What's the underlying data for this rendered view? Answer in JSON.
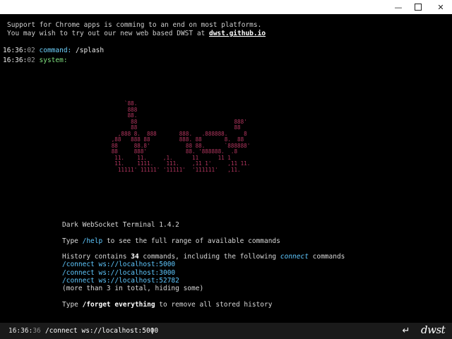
{
  "window": {
    "minimize_glyph": "—",
    "close_glyph": "✕"
  },
  "notice": {
    "line1": "Support for Chrome apps is comming to an end on most platforms.",
    "line2_prefix": "You may wish to try out our new web based DWST at ",
    "link": "dwst.github.io"
  },
  "log": [
    {
      "time_hm": "16:36:",
      "time_s": "02",
      "label": "command:",
      "value": "/splash"
    },
    {
      "time_hm": "16:36:",
      "time_s": "02",
      "label": "system:",
      "value": ""
    }
  ],
  "logo_art": "              `88.\n               888\n               88.\n                88                              888'\n                88                              88\n            ,888 8.  888       888.   .888888.     8\n          ,88   888 88         888. 88       8.  88\n          88     88.8'           88 88.      `888888'\n          88     888'            88. '888888.  .8\n           11.    11.     ,1.      11      11 1\n           11.    1111.    111.    ,11 1'     ,11 11.\n            11111' 11111' '11111'  '111111'   ,11.",
  "splash": {
    "title": "Dark WebSocket Terminal 1.4.2",
    "help_prefix": "Type ",
    "help_cmd": "/help",
    "help_suffix": " to see the full range of available commands",
    "history_prefix": "History contains ",
    "history_count": "34",
    "history_mid": " commands, including the following ",
    "history_kw": "connect",
    "history_suffix": " commands",
    "history_items": [
      "/connect ws://localhost:5000",
      "/connect ws://localhost:3000",
      "/connect ws://localhost:52782"
    ],
    "more_note": "(more than 3 in total, hiding some)",
    "forget_prefix": "Type ",
    "forget_cmd": "/forget everything",
    "forget_suffix": " to remove all stored history"
  },
  "input": {
    "time_hm": "16:36:",
    "time_s": "36",
    "value": "/connect ws://localhost:5000",
    "enter_glyph": "↵",
    "logo_text": "dwst"
  }
}
